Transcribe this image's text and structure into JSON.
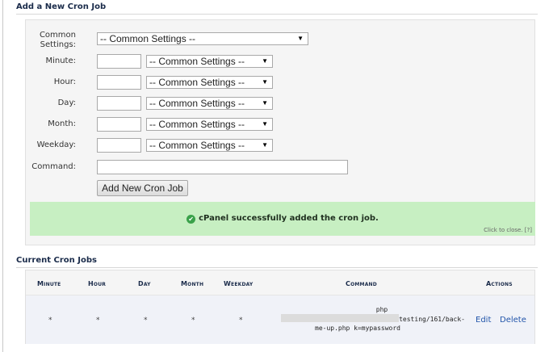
{
  "add_section": {
    "title": "Add a New Cron Job",
    "common_settings_label": "Common Settings:",
    "common_settings_value": "-- Common Settings --",
    "fields": [
      {
        "label": "Minute:",
        "select_value": "-- Common Settings --",
        "value": ""
      },
      {
        "label": "Hour:",
        "select_value": "-- Common Settings --",
        "value": ""
      },
      {
        "label": "Day:",
        "select_value": "-- Common Settings --",
        "value": ""
      },
      {
        "label": "Month:",
        "select_value": "-- Common Settings --",
        "value": ""
      },
      {
        "label": "Weekday:",
        "select_value": "-- Common Settings --",
        "value": ""
      }
    ],
    "command_label": "Command:",
    "command_value": "",
    "add_button": "Add New Cron Job",
    "success_message": "cPanel successfully added the cron job.",
    "close_hint": "Click to close. [?]"
  },
  "jobs_section": {
    "title": "Current Cron Jobs",
    "headers": {
      "minute": "Minute",
      "hour": "Hour",
      "day": "Day",
      "month": "Month",
      "weekday": "Weekday",
      "command": "Command",
      "actions": "Actions"
    },
    "rows": [
      {
        "minute": "*",
        "hour": "*",
        "day": "*",
        "month": "*",
        "weekday": "*",
        "command_line1": "php",
        "command_line2": "testing/161/back-",
        "command_line3": "me-up.php k=mypassword",
        "edit": "Edit",
        "delete": "Delete"
      }
    ]
  },
  "colors": {
    "success_bg": "#c7efc2",
    "link": "#2255aa",
    "title": "#1a2b4a"
  }
}
